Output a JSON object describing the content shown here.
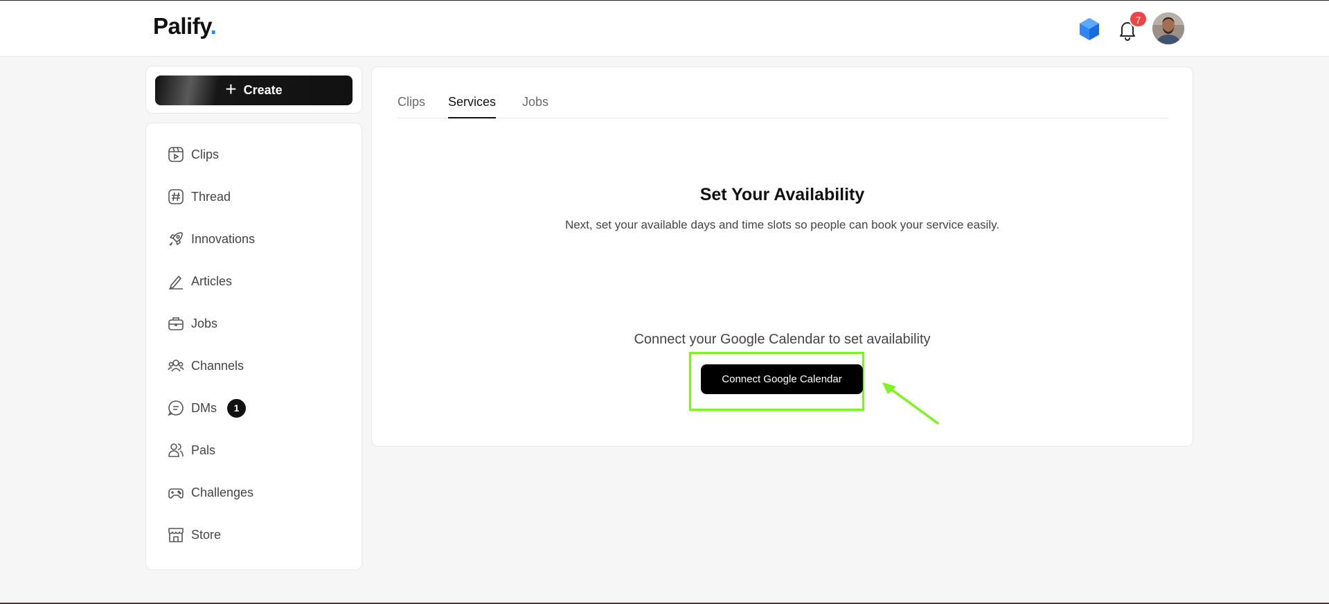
{
  "header": {
    "logo_text": "Palify",
    "logo_dot": ".",
    "gem_icon": "blue-cube-gem-icon",
    "notifications_count": "7",
    "brand_dot_color": "#1a8cff",
    "badge_color": "#ef4444"
  },
  "sidebar": {
    "create_label": "Create",
    "items": [
      {
        "label": "Clips",
        "icon": "clips-icon"
      },
      {
        "label": "Thread",
        "icon": "hash-icon"
      },
      {
        "label": "Innovations",
        "icon": "rocket-icon"
      },
      {
        "label": "Articles",
        "icon": "pen-icon"
      },
      {
        "label": "Jobs",
        "icon": "briefcase-icon"
      },
      {
        "label": "Channels",
        "icon": "users-group-icon"
      },
      {
        "label": "DMs",
        "icon": "chat-icon",
        "badge": "1"
      },
      {
        "label": "Pals",
        "icon": "users-icon"
      },
      {
        "label": "Challenges",
        "icon": "gamepad-icon"
      },
      {
        "label": "Store",
        "icon": "store-icon"
      }
    ]
  },
  "main": {
    "tabs": [
      {
        "label": "Clips",
        "active": false
      },
      {
        "label": "Services",
        "active": true
      },
      {
        "label": "Jobs",
        "active": false
      }
    ],
    "title": "Set Your Availability",
    "subtitle": "Next, set your available days and time slots so people can book your service easily.",
    "connect_prompt": "Connect your Google Calendar to set availability",
    "connect_button": "Connect Google Calendar",
    "highlight_color": "#7cf51a"
  }
}
